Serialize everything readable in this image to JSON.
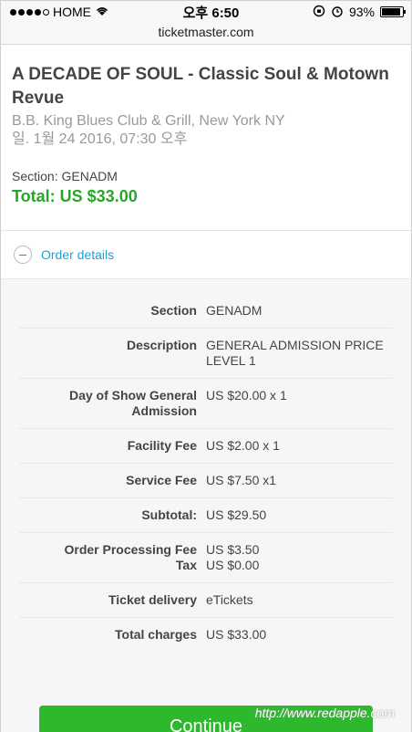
{
  "status_bar": {
    "carrier": "HOME",
    "time": "오후 6:50",
    "battery_pct": "93%",
    "battery_level": 0.93
  },
  "browser": {
    "url": "ticketmaster.com"
  },
  "event": {
    "title": "A DECADE OF SOUL - Classic Soul & Motown Revue",
    "venue": "B.B. King Blues Club & Grill, New York NY",
    "date": "일. 1월 24 2016, 07:30 오후",
    "section": "Section: GENADM",
    "total": "Total: US $33.00"
  },
  "order_details": {
    "toggle_label": "Order details",
    "rows": [
      {
        "label": "Section",
        "value": "GENADM"
      },
      {
        "label": "Description",
        "value": "GENERAL ADMISSION PRICE LEVEL 1"
      },
      {
        "label": "Day of Show General Admission",
        "value": "US $20.00 x 1"
      },
      {
        "label": "Facility Fee",
        "value": "US $2.00 x 1"
      },
      {
        "label": "Service Fee",
        "value": "US $7.50 x1"
      },
      {
        "label": "Subtotal:",
        "value": "US $29.50"
      },
      {
        "label": "Order Processing Fee",
        "value": "US $3.50"
      },
      {
        "label": "Tax",
        "value": "US $0.00"
      },
      {
        "label": "Ticket delivery",
        "value": "eTickets"
      },
      {
        "label": "Total charges",
        "value": "US $33.00"
      }
    ]
  },
  "actions": {
    "continue_label": "Continue"
  },
  "watermark": "http://www.redapple.com",
  "colors": {
    "total_green": "#27a727",
    "link_blue": "#1aa3d8",
    "button_green": "#2eb82e"
  }
}
